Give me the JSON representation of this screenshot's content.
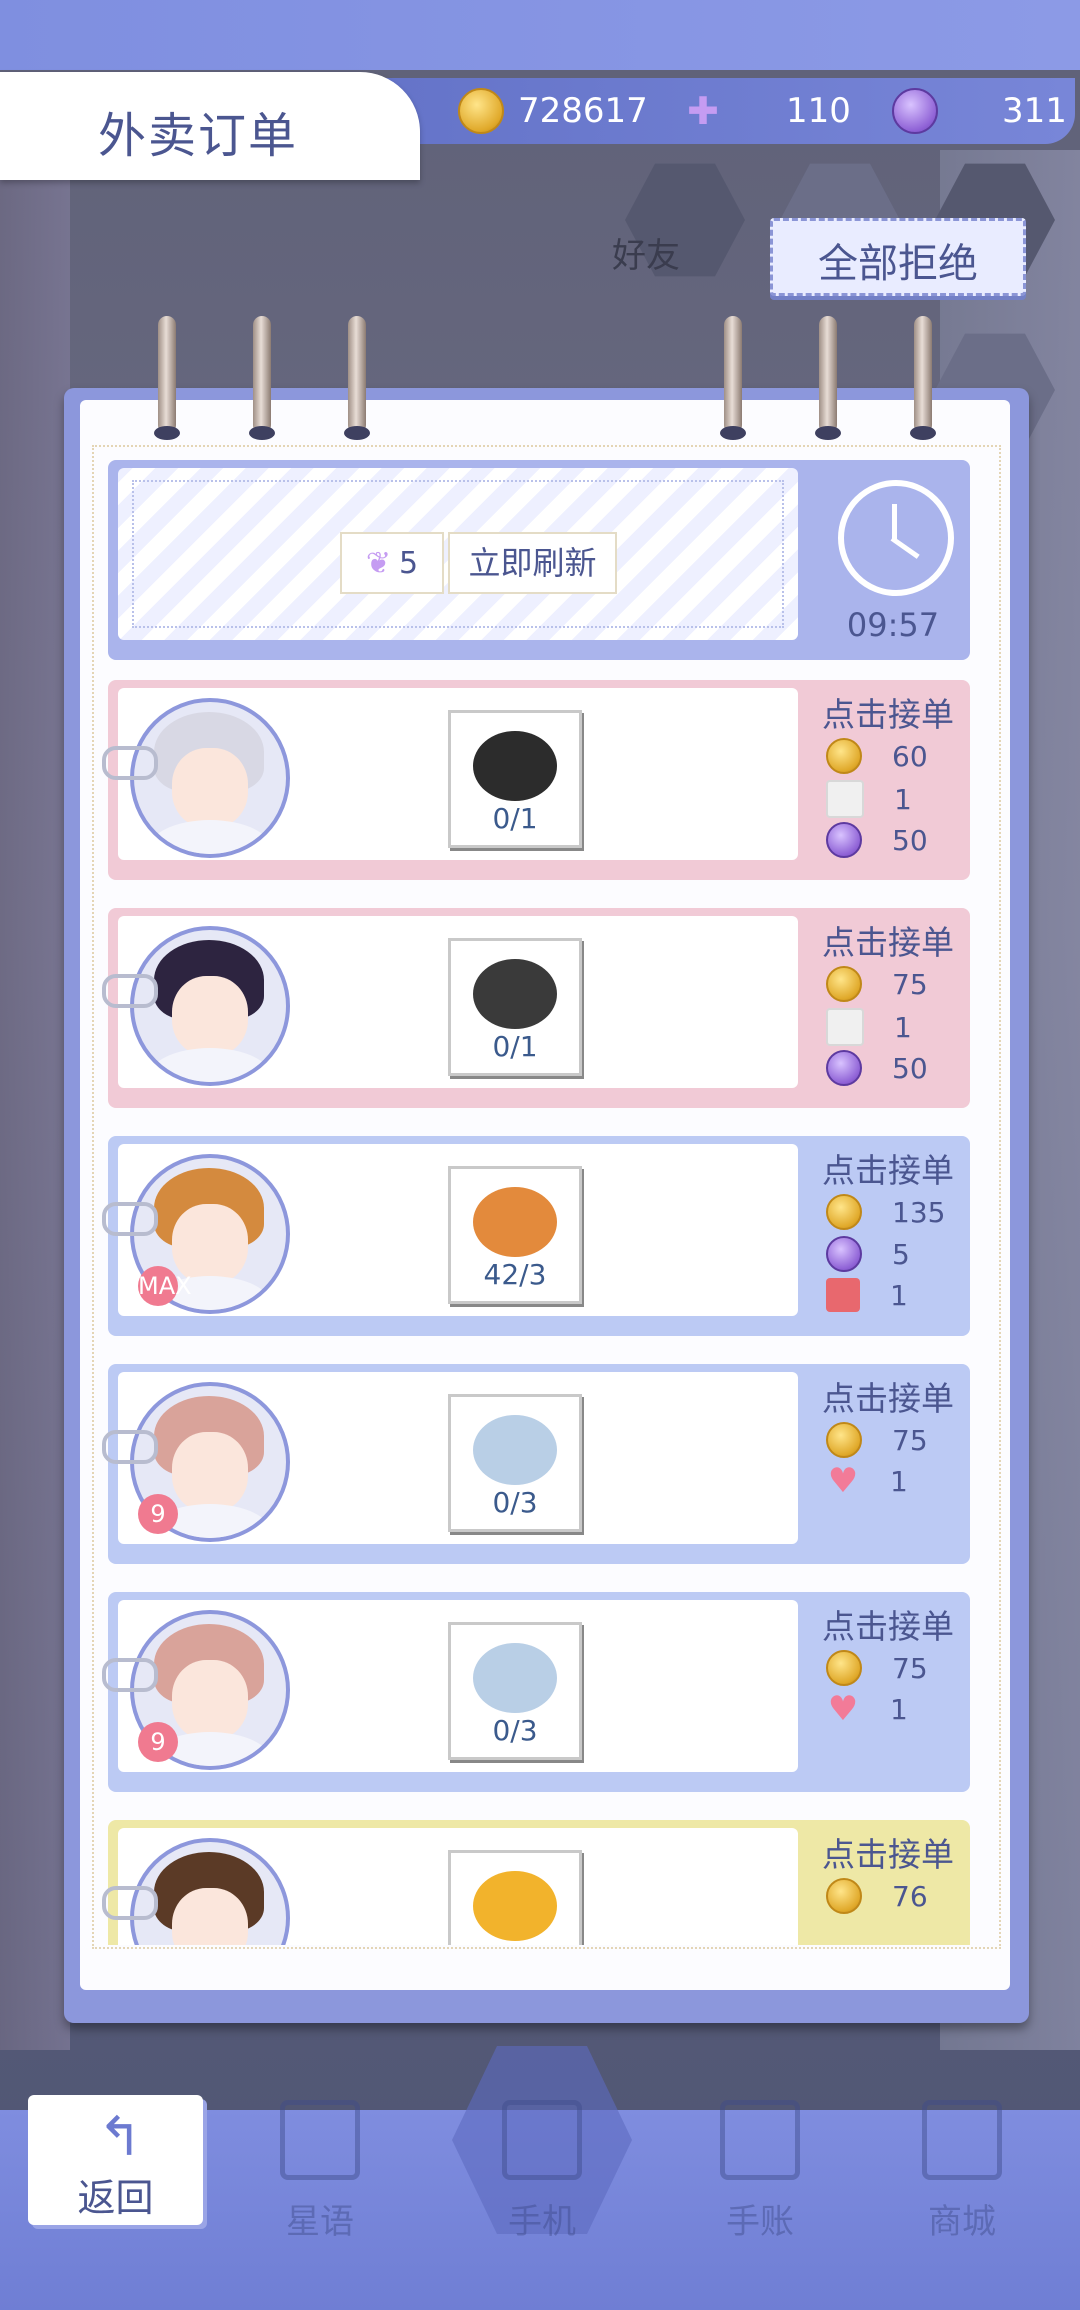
{
  "header": {
    "title": "外卖订单"
  },
  "resources": {
    "gold": "728617",
    "swans": "110",
    "gems": "311"
  },
  "reject_all_label": "全部拒绝",
  "background_labels": {
    "friends": "好友"
  },
  "refresh": {
    "cost": "5",
    "button_label": "立即刷新",
    "timer": "09:57"
  },
  "orders": [
    {
      "theme": "pink",
      "item_count": "0/1",
      "accept_label": "点击接单",
      "hair": "#d8d8e4",
      "dish": "#2c2c2c",
      "rewards": [
        {
          "icon": "coin-icon",
          "value": "60"
        },
        {
          "icon": "card-icon",
          "value": "1"
        },
        {
          "icon": "gem-icon",
          "value": "50"
        }
      ]
    },
    {
      "theme": "pink",
      "item_count": "0/1",
      "accept_label": "点击接单",
      "hair": "#2d2440",
      "dish": "#3a3a3a",
      "rewards": [
        {
          "icon": "coin-icon",
          "value": "75"
        },
        {
          "icon": "card-icon",
          "value": "1"
        },
        {
          "icon": "gem-icon",
          "value": "50"
        }
      ]
    },
    {
      "theme": "blue",
      "item_count": "42/3",
      "accept_label": "点击接单",
      "hair": "#d48a3e",
      "dish": "#e38a3c",
      "badge": "MAX",
      "rewards": [
        {
          "icon": "coin-icon",
          "value": "135"
        },
        {
          "icon": "gem-icon",
          "value": "5"
        },
        {
          "icon": "ticket-icon",
          "value": "1"
        }
      ]
    },
    {
      "theme": "blue",
      "item_count": "0/3",
      "accept_label": "点击接单",
      "hair": "#d9a39a",
      "dish": "#b9cfe6",
      "badge": "9",
      "rewards": [
        {
          "icon": "coin-icon",
          "value": "75"
        },
        {
          "icon": "heart-icon",
          "value": "1"
        }
      ]
    },
    {
      "theme": "blue",
      "item_count": "0/3",
      "accept_label": "点击接单",
      "hair": "#d9a39a",
      "dish": "#b9cfe6",
      "badge": "9",
      "rewards": [
        {
          "icon": "coin-icon",
          "value": "75"
        },
        {
          "icon": "heart-icon",
          "value": "1"
        }
      ]
    },
    {
      "theme": "yellow",
      "item_count": "",
      "accept_label": "点击接单",
      "hair": "#5b3a26",
      "dish": "#f2b32c",
      "rewards": [
        {
          "icon": "coin-icon",
          "value": "76"
        }
      ]
    }
  ],
  "bottom_nav": {
    "back_label": "返回",
    "items": [
      {
        "label": "星语"
      },
      {
        "label": "手机"
      },
      {
        "label": "手账"
      },
      {
        "label": "商城"
      }
    ]
  }
}
